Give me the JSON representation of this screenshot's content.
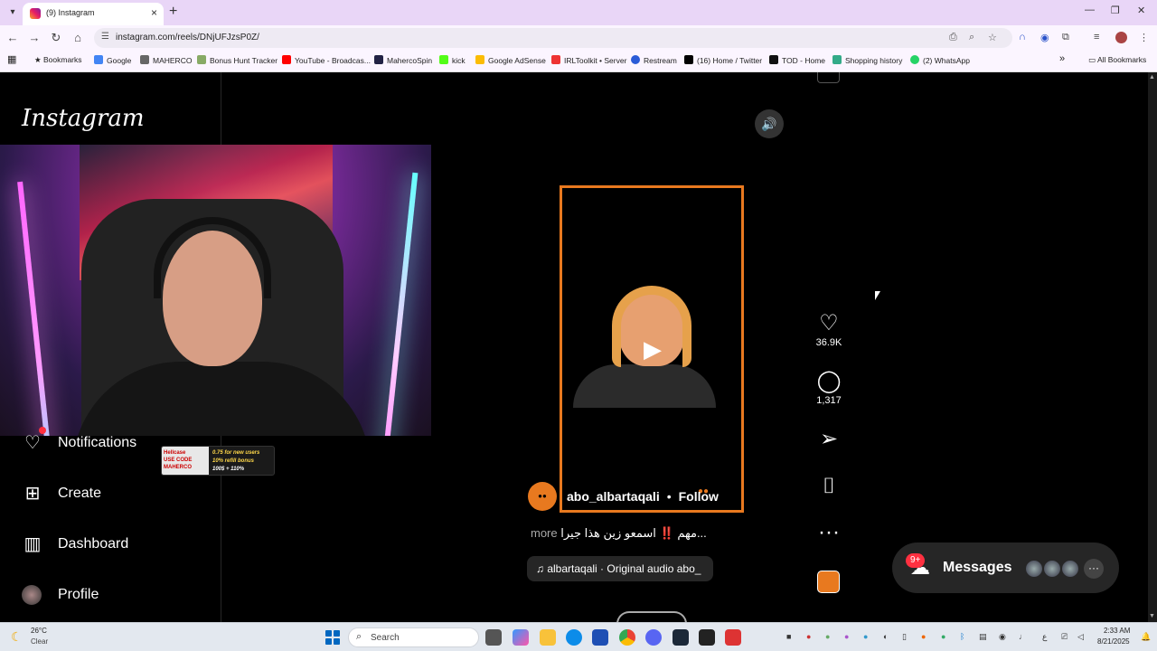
{
  "browser": {
    "tab_title": "(9) Instagram",
    "url": "instagram.com/reels/DNjUFJzsP0Z/",
    "bookmarks": [
      {
        "label": "Bookmarks",
        "icon": "star-icon"
      },
      {
        "label": "Google",
        "icon": "google-icon"
      },
      {
        "label": "MAHERCO",
        "icon": "maherco-icon"
      },
      {
        "label": "Bonus Hunt Tracker",
        "icon": "bonus-icon"
      },
      {
        "label": "YouTube - Broadcas...",
        "icon": "youtube-icon"
      },
      {
        "label": "MahercoSpin",
        "icon": "spin-icon"
      },
      {
        "label": "kick",
        "icon": "kick-icon"
      },
      {
        "label": "Google AdSense",
        "icon": "adsense-icon"
      },
      {
        "label": "IRLToolkit • Server",
        "icon": "irl-icon"
      },
      {
        "label": "Restream",
        "icon": "restream-icon"
      },
      {
        "label": "(16) Home / Twitter",
        "icon": "x-icon"
      },
      {
        "label": "TOD - Home",
        "icon": "tod-icon"
      },
      {
        "label": "Shopping history",
        "icon": "shopping-icon"
      },
      {
        "label": "(2) WhatsApp",
        "icon": "whatsapp-icon"
      }
    ],
    "all_bookmarks": "All Bookmarks",
    "colors": {
      "tab_strip": "#e9d6f7",
      "toolbar": "#fbf5ff"
    }
  },
  "instagram": {
    "logo": "Instagram",
    "nav": {
      "notifications": "Notifications",
      "create": "Create",
      "dashboard": "Dashboard",
      "profile": "Profile"
    },
    "promo": {
      "left": "Hellcase\nUSE CODE\nMAHERCO",
      "right_1": "0.75 for new users",
      "right_2": "10% refill bonus",
      "right_3": "100$ + 110%"
    },
    "reel": {
      "author": "abo_albartaqali",
      "separator": "•",
      "follow": "Follow",
      "caption": "مهم ‼️ اسمعو زين هذا جيرا...",
      "caption_more": "more",
      "audio": "♫ albartaqali · Original audio  abo_",
      "likes": "36.9K",
      "comments": "1,317",
      "accent": "#e8791f"
    },
    "messages": {
      "label": "Messages",
      "badge": "9+"
    }
  },
  "taskbar": {
    "weather_temp": "26°C",
    "weather_cond": "Clear",
    "search": "Search",
    "time": "2:33 AM",
    "date": "8/21/2025"
  }
}
